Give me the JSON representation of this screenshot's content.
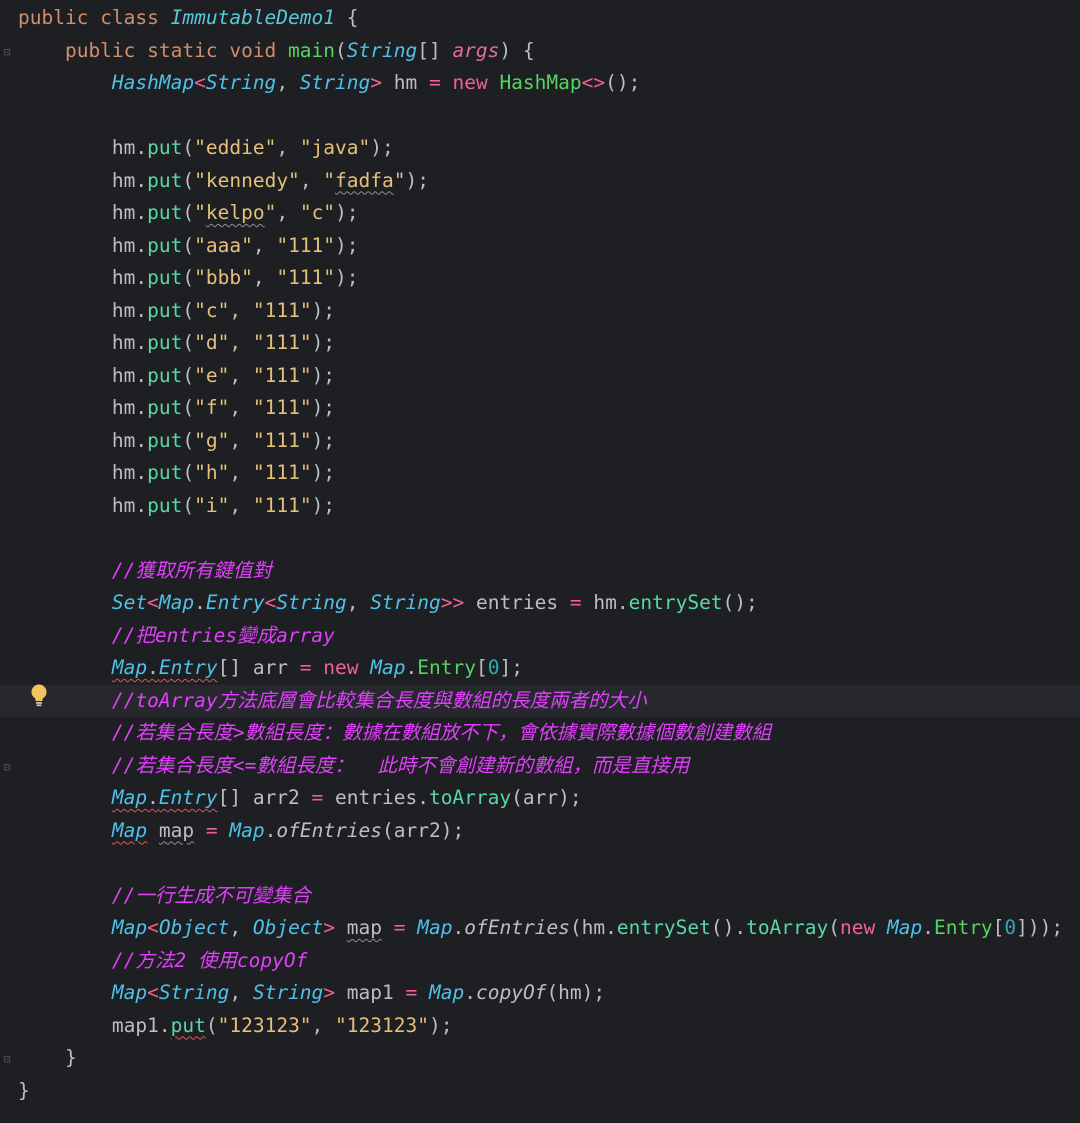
{
  "editor": {
    "lines": [
      [
        {
          "t": "public ",
          "c": "kw"
        },
        {
          "t": "class ",
          "c": "kw"
        },
        {
          "t": "ImmutableDemo1",
          "c": "classname"
        },
        {
          "t": " {",
          "c": "plain"
        }
      ],
      [
        {
          "t": "    public ",
          "c": "kw"
        },
        {
          "t": "static ",
          "c": "kw"
        },
        {
          "t": "void ",
          "c": "kw"
        },
        {
          "t": "main",
          "c": "fn"
        },
        {
          "t": "(",
          "c": "plain"
        },
        {
          "t": "String",
          "c": "type"
        },
        {
          "t": "[] ",
          "c": "plain"
        },
        {
          "t": "args",
          "c": "param"
        },
        {
          "t": ") {",
          "c": "plain"
        }
      ],
      [
        {
          "t": "        ",
          "c": "plain"
        },
        {
          "t": "HashMap",
          "c": "type"
        },
        {
          "t": "<",
          "c": "op"
        },
        {
          "t": "String",
          "c": "type"
        },
        {
          "t": ", ",
          "c": "plain"
        },
        {
          "t": "String",
          "c": "type"
        },
        {
          "t": ">",
          "c": "op"
        },
        {
          "t": " hm ",
          "c": "plain"
        },
        {
          "t": "=",
          "c": "op"
        },
        {
          "t": " ",
          "c": "plain"
        },
        {
          "t": "new ",
          "c": "op"
        },
        {
          "t": "HashMap",
          "c": "entry"
        },
        {
          "t": "<>",
          "c": "op"
        },
        {
          "t": "();",
          "c": "plain"
        }
      ],
      [],
      [
        {
          "t": "        hm",
          "c": "plain"
        },
        {
          "t": ".",
          "c": "plain"
        },
        {
          "t": "put",
          "c": "method"
        },
        {
          "t": "(",
          "c": "plain"
        },
        {
          "t": "\"eddie\"",
          "c": "str"
        },
        {
          "t": ", ",
          "c": "plain"
        },
        {
          "t": "\"java\"",
          "c": "str"
        },
        {
          "t": ");",
          "c": "plain"
        }
      ],
      [
        {
          "t": "        hm",
          "c": "plain"
        },
        {
          "t": ".",
          "c": "plain"
        },
        {
          "t": "put",
          "c": "method"
        },
        {
          "t": "(",
          "c": "plain"
        },
        {
          "t": "\"kennedy\"",
          "c": "str"
        },
        {
          "t": ", ",
          "c": "plain"
        },
        {
          "t": "\"",
          "c": "str"
        },
        {
          "t": "fadfa",
          "c": "str",
          "u": "grey"
        },
        {
          "t": "\"",
          "c": "str"
        },
        {
          "t": ");",
          "c": "plain"
        }
      ],
      [
        {
          "t": "        hm",
          "c": "plain"
        },
        {
          "t": ".",
          "c": "plain"
        },
        {
          "t": "put",
          "c": "method"
        },
        {
          "t": "(",
          "c": "plain"
        },
        {
          "t": "\"",
          "c": "str"
        },
        {
          "t": "kelpo",
          "c": "str",
          "u": "grey"
        },
        {
          "t": "\"",
          "c": "str"
        },
        {
          "t": ", ",
          "c": "plain"
        },
        {
          "t": "\"c\"",
          "c": "str"
        },
        {
          "t": ");",
          "c": "plain"
        }
      ],
      [
        {
          "t": "        hm",
          "c": "plain"
        },
        {
          "t": ".",
          "c": "plain"
        },
        {
          "t": "put",
          "c": "method"
        },
        {
          "t": "(",
          "c": "plain"
        },
        {
          "t": "\"aaa\"",
          "c": "str"
        },
        {
          "t": ", ",
          "c": "plain"
        },
        {
          "t": "\"111\"",
          "c": "str"
        },
        {
          "t": ");",
          "c": "plain"
        }
      ],
      [
        {
          "t": "        hm",
          "c": "plain"
        },
        {
          "t": ".",
          "c": "plain"
        },
        {
          "t": "put",
          "c": "method"
        },
        {
          "t": "(",
          "c": "plain"
        },
        {
          "t": "\"bbb\"",
          "c": "str"
        },
        {
          "t": ", ",
          "c": "plain"
        },
        {
          "t": "\"111\"",
          "c": "str"
        },
        {
          "t": ");",
          "c": "plain"
        }
      ],
      [
        {
          "t": "        hm",
          "c": "plain"
        },
        {
          "t": ".",
          "c": "plain"
        },
        {
          "t": "put",
          "c": "method"
        },
        {
          "t": "(",
          "c": "plain"
        },
        {
          "t": "\"c\"",
          "c": "str"
        },
        {
          "t": ", ",
          "c": "plain"
        },
        {
          "t": "\"111\"",
          "c": "str"
        },
        {
          "t": ");",
          "c": "plain"
        }
      ],
      [
        {
          "t": "        hm",
          "c": "plain"
        },
        {
          "t": ".",
          "c": "plain"
        },
        {
          "t": "put",
          "c": "method"
        },
        {
          "t": "(",
          "c": "plain"
        },
        {
          "t": "\"d\"",
          "c": "str"
        },
        {
          "t": ", ",
          "c": "plain"
        },
        {
          "t": "\"111\"",
          "c": "str"
        },
        {
          "t": ");",
          "c": "plain"
        }
      ],
      [
        {
          "t": "        hm",
          "c": "plain"
        },
        {
          "t": ".",
          "c": "plain"
        },
        {
          "t": "put",
          "c": "method"
        },
        {
          "t": "(",
          "c": "plain"
        },
        {
          "t": "\"e\"",
          "c": "str"
        },
        {
          "t": ", ",
          "c": "plain"
        },
        {
          "t": "\"111\"",
          "c": "str"
        },
        {
          "t": ");",
          "c": "plain"
        }
      ],
      [
        {
          "t": "        hm",
          "c": "plain"
        },
        {
          "t": ".",
          "c": "plain"
        },
        {
          "t": "put",
          "c": "method"
        },
        {
          "t": "(",
          "c": "plain"
        },
        {
          "t": "\"f\"",
          "c": "str"
        },
        {
          "t": ", ",
          "c": "plain"
        },
        {
          "t": "\"111\"",
          "c": "str"
        },
        {
          "t": ");",
          "c": "plain"
        }
      ],
      [
        {
          "t": "        hm",
          "c": "plain"
        },
        {
          "t": ".",
          "c": "plain"
        },
        {
          "t": "put",
          "c": "method"
        },
        {
          "t": "(",
          "c": "plain"
        },
        {
          "t": "\"g\"",
          "c": "str"
        },
        {
          "t": ", ",
          "c": "plain"
        },
        {
          "t": "\"111\"",
          "c": "str"
        },
        {
          "t": ");",
          "c": "plain"
        }
      ],
      [
        {
          "t": "        hm",
          "c": "plain"
        },
        {
          "t": ".",
          "c": "plain"
        },
        {
          "t": "put",
          "c": "method"
        },
        {
          "t": "(",
          "c": "plain"
        },
        {
          "t": "\"h\"",
          "c": "str"
        },
        {
          "t": ", ",
          "c": "plain"
        },
        {
          "t": "\"111\"",
          "c": "str"
        },
        {
          "t": ");",
          "c": "plain"
        }
      ],
      [
        {
          "t": "        hm",
          "c": "plain"
        },
        {
          "t": ".",
          "c": "plain"
        },
        {
          "t": "put",
          "c": "method"
        },
        {
          "t": "(",
          "c": "plain"
        },
        {
          "t": "\"i\"",
          "c": "str"
        },
        {
          "t": ", ",
          "c": "plain"
        },
        {
          "t": "\"111\"",
          "c": "str"
        },
        {
          "t": ");",
          "c": "plain"
        }
      ],
      [],
      [
        {
          "t": "        ",
          "c": "plain"
        },
        {
          "t": "//獲取所有鍵值對",
          "c": "comment"
        }
      ],
      [
        {
          "t": "        ",
          "c": "plain"
        },
        {
          "t": "Set",
          "c": "type"
        },
        {
          "t": "<",
          "c": "op"
        },
        {
          "t": "Map",
          "c": "type"
        },
        {
          "t": ".",
          "c": "plain"
        },
        {
          "t": "Entry",
          "c": "type"
        },
        {
          "t": "<",
          "c": "op"
        },
        {
          "t": "String",
          "c": "type"
        },
        {
          "t": ", ",
          "c": "plain"
        },
        {
          "t": "String",
          "c": "type"
        },
        {
          "t": ">>",
          "c": "op"
        },
        {
          "t": " entries ",
          "c": "plain"
        },
        {
          "t": "=",
          "c": "op"
        },
        {
          "t": " hm",
          "c": "plain"
        },
        {
          "t": ".",
          "c": "plain"
        },
        {
          "t": "entrySet",
          "c": "method"
        },
        {
          "t": "();",
          "c": "plain"
        }
      ],
      [
        {
          "t": "        ",
          "c": "plain"
        },
        {
          "t": "//把entries變成array",
          "c": "comment"
        }
      ],
      [
        {
          "t": "        ",
          "c": "plain"
        },
        {
          "t": "Map",
          "c": "type",
          "u": "red"
        },
        {
          "t": ".",
          "c": "plain",
          "u": "red"
        },
        {
          "t": "Entry",
          "c": "type",
          "u": "red"
        },
        {
          "t": "[] arr ",
          "c": "plain"
        },
        {
          "t": "=",
          "c": "op"
        },
        {
          "t": " ",
          "c": "plain"
        },
        {
          "t": "new ",
          "c": "op"
        },
        {
          "t": "Map",
          "c": "type"
        },
        {
          "t": ".",
          "c": "plain"
        },
        {
          "t": "Entry",
          "c": "entry"
        },
        {
          "t": "[",
          "c": "plain"
        },
        {
          "t": "0",
          "c": "num"
        },
        {
          "t": "];",
          "c": "plain"
        }
      ],
      [
        {
          "t": "        ",
          "c": "plain"
        },
        {
          "t": "//toArray方法底層會比較集合長度與數組的長度兩者的大小",
          "c": "comment"
        }
      ],
      [
        {
          "t": "        ",
          "c": "plain"
        },
        {
          "t": "//若集合長度>數組長度：數據在數組放不下，會依據實際數據個數創建數組",
          "c": "comment"
        }
      ],
      [
        {
          "t": "        ",
          "c": "plain"
        },
        {
          "t": "//若集合長度<=數組長度：  此時不會創建新的數組，而是直接用",
          "c": "comment"
        }
      ],
      [
        {
          "t": "        ",
          "c": "plain"
        },
        {
          "t": "Map",
          "c": "type",
          "u": "red"
        },
        {
          "t": ".",
          "c": "plain",
          "u": "red"
        },
        {
          "t": "Entry",
          "c": "type",
          "u": "red"
        },
        {
          "t": "[] arr2 ",
          "c": "plain"
        },
        {
          "t": "=",
          "c": "op"
        },
        {
          "t": " entries",
          "c": "plain"
        },
        {
          "t": ".",
          "c": "plain"
        },
        {
          "t": "toArray",
          "c": "method"
        },
        {
          "t": "(arr);",
          "c": "plain"
        }
      ],
      [
        {
          "t": "        ",
          "c": "plain"
        },
        {
          "t": "Map",
          "c": "type",
          "u": "red"
        },
        {
          "t": " ",
          "c": "plain"
        },
        {
          "t": "map",
          "c": "plain",
          "u": "grey"
        },
        {
          "t": " ",
          "c": "plain"
        },
        {
          "t": "=",
          "c": "op"
        },
        {
          "t": " ",
          "c": "plain"
        },
        {
          "t": "Map",
          "c": "type"
        },
        {
          "t": ".",
          "c": "plain"
        },
        {
          "t": "ofEntries",
          "c": "staticm"
        },
        {
          "t": "(arr2);",
          "c": "plain"
        }
      ],
      [],
      [
        {
          "t": "        ",
          "c": "plain"
        },
        {
          "t": "//一行生成不可變集合",
          "c": "comment"
        }
      ],
      [
        {
          "t": "        ",
          "c": "plain"
        },
        {
          "t": "Map",
          "c": "type"
        },
        {
          "t": "<",
          "c": "op"
        },
        {
          "t": "Object",
          "c": "type"
        },
        {
          "t": ", ",
          "c": "plain"
        },
        {
          "t": "Object",
          "c": "type"
        },
        {
          "t": ">",
          "c": "op"
        },
        {
          "t": " ",
          "c": "plain"
        },
        {
          "t": "map",
          "c": "plain",
          "u": "grey"
        },
        {
          "t": " ",
          "c": "plain"
        },
        {
          "t": "=",
          "c": "op"
        },
        {
          "t": " ",
          "c": "plain"
        },
        {
          "t": "Map",
          "c": "type"
        },
        {
          "t": ".",
          "c": "plain"
        },
        {
          "t": "ofEntries",
          "c": "staticm"
        },
        {
          "t": "(hm",
          "c": "plain"
        },
        {
          "t": ".",
          "c": "plain"
        },
        {
          "t": "entrySet",
          "c": "method"
        },
        {
          "t": "()",
          "c": "plain"
        },
        {
          "t": ".",
          "c": "plain"
        },
        {
          "t": "toArray",
          "c": "method"
        },
        {
          "t": "(",
          "c": "plain"
        },
        {
          "t": "new ",
          "c": "op"
        },
        {
          "t": "Map",
          "c": "type"
        },
        {
          "t": ".",
          "c": "plain"
        },
        {
          "t": "Entry",
          "c": "entry"
        },
        {
          "t": "[",
          "c": "plain"
        },
        {
          "t": "0",
          "c": "num"
        },
        {
          "t": "]));",
          "c": "plain"
        }
      ],
      [
        {
          "t": "        ",
          "c": "plain"
        },
        {
          "t": "//方法2 使用copyOf",
          "c": "comment"
        }
      ],
      [
        {
          "t": "        ",
          "c": "plain"
        },
        {
          "t": "Map",
          "c": "type"
        },
        {
          "t": "<",
          "c": "op"
        },
        {
          "t": "String",
          "c": "type"
        },
        {
          "t": ", ",
          "c": "plain"
        },
        {
          "t": "String",
          "c": "type"
        },
        {
          "t": ">",
          "c": "op"
        },
        {
          "t": " map1 ",
          "c": "plain"
        },
        {
          "t": "=",
          "c": "op"
        },
        {
          "t": " ",
          "c": "plain"
        },
        {
          "t": "Map",
          "c": "type"
        },
        {
          "t": ".",
          "c": "plain"
        },
        {
          "t": "copyOf",
          "c": "staticm"
        },
        {
          "t": "(hm);",
          "c": "plain"
        }
      ],
      [
        {
          "t": "        map1",
          "c": "plain"
        },
        {
          "t": ".",
          "c": "plain"
        },
        {
          "t": "put",
          "c": "method",
          "u": "red"
        },
        {
          "t": "(",
          "c": "plain"
        },
        {
          "t": "\"123123\"",
          "c": "str"
        },
        {
          "t": ", ",
          "c": "plain"
        },
        {
          "t": "\"123123\"",
          "c": "str"
        },
        {
          "t": ");",
          "c": "plain"
        }
      ],
      [
        {
          "t": "    }",
          "c": "plain"
        }
      ],
      [
        {
          "t": "}",
          "c": "plain"
        }
      ]
    ],
    "caret_line": 21,
    "gutter_marks": [
      {
        "line": 1,
        "icon": "fold-icon"
      },
      {
        "line": 21,
        "icon": "bookmark-icon"
      },
      {
        "line": 23,
        "icon": "fold-icon"
      },
      {
        "line": 32,
        "icon": "fold-icon"
      }
    ],
    "intention_icon": "lightbulb-icon"
  },
  "colors": {
    "background": "#1e1f22",
    "caret_row": "#26282e",
    "keyword": "#cf8e6d",
    "string": "#e5c07b",
    "comment": "#e040fb",
    "type": "#4fc1e9",
    "method": "#57d9a3",
    "lightbulb": "#f2c55c"
  }
}
